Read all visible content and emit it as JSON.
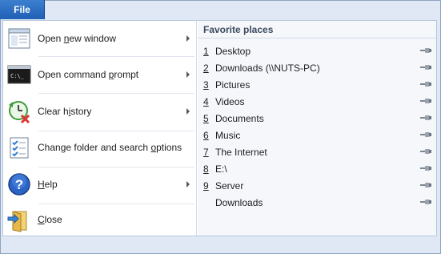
{
  "file_tab": {
    "label": "File"
  },
  "left_menu": [
    {
      "name": "open-new-window",
      "icon": "window-icon",
      "pre": "Open ",
      "acc": "n",
      "post": "ew window",
      "has_submenu": true
    },
    {
      "name": "open-command-prompt",
      "icon": "command-prompt-icon",
      "pre": "Open command ",
      "acc": "p",
      "post": "rompt",
      "has_submenu": true
    },
    {
      "name": "clear-history",
      "icon": "clear-history-icon",
      "pre": "Clear h",
      "acc": "i",
      "post": "story",
      "has_submenu": true
    },
    {
      "name": "change-folder-options",
      "icon": "options-checklist-icon",
      "pre": "Change folder and search ",
      "acc": "o",
      "post": "ptions",
      "has_submenu": false
    },
    {
      "name": "help",
      "icon": "help-icon",
      "pre": "",
      "acc": "H",
      "post": "elp",
      "has_submenu": true
    },
    {
      "name": "close",
      "icon": "close-door-icon",
      "pre": "",
      "acc": "C",
      "post": "lose",
      "has_submenu": false
    }
  ],
  "favorites": {
    "header": "Favorite places",
    "items": [
      {
        "num": "1",
        "label": "Desktop"
      },
      {
        "num": "2",
        "label": "Downloads (\\\\NUTS-PC)"
      },
      {
        "num": "3",
        "label": "Pictures"
      },
      {
        "num": "4",
        "label": "Videos"
      },
      {
        "num": "5",
        "label": "Documents"
      },
      {
        "num": "6",
        "label": "Music"
      },
      {
        "num": "7",
        "label": "The Internet"
      },
      {
        "num": "8",
        "label": "E:\\"
      },
      {
        "num": "9",
        "label": "Server"
      },
      {
        "num": "",
        "label": "Downloads"
      }
    ]
  }
}
